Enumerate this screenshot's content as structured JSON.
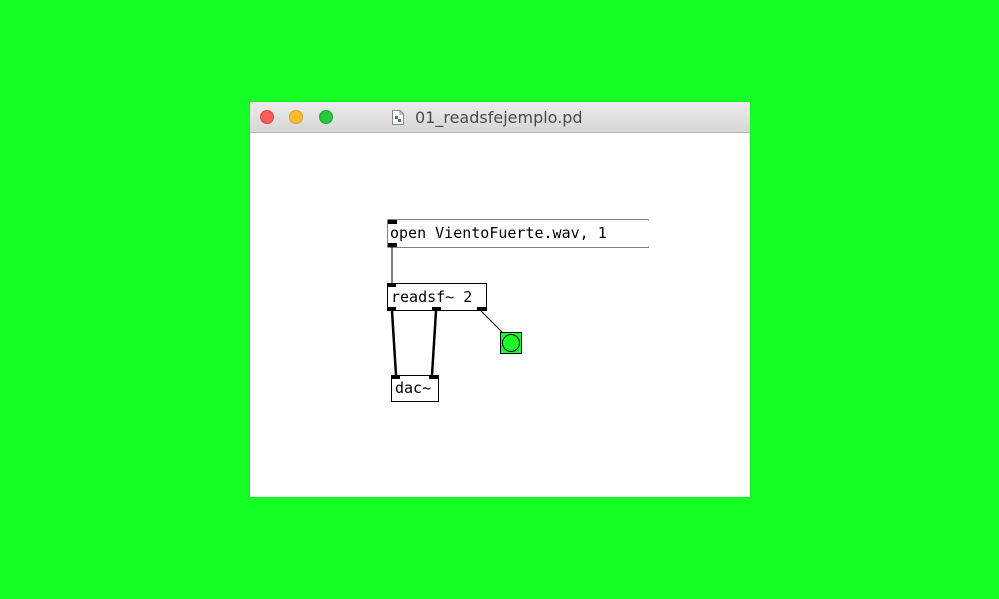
{
  "window": {
    "title": "01_readsfejemplo.pd",
    "file_icon": "pd-document-icon",
    "controls": [
      "close",
      "minimize",
      "zoom"
    ]
  },
  "patch": {
    "message_box": {
      "text": "open VientoFuerte.wav, 1"
    },
    "readsf_object": {
      "text": "readsf~ 2"
    },
    "dac_object": {
      "text": "dac~"
    },
    "bang": {
      "type": "bng",
      "color": "#1aff2a"
    }
  },
  "colors": {
    "background": "#15ff26",
    "window": "#ffffff",
    "close": "#fc5b57",
    "minimize": "#febb2e",
    "zoom": "#26c83f"
  }
}
